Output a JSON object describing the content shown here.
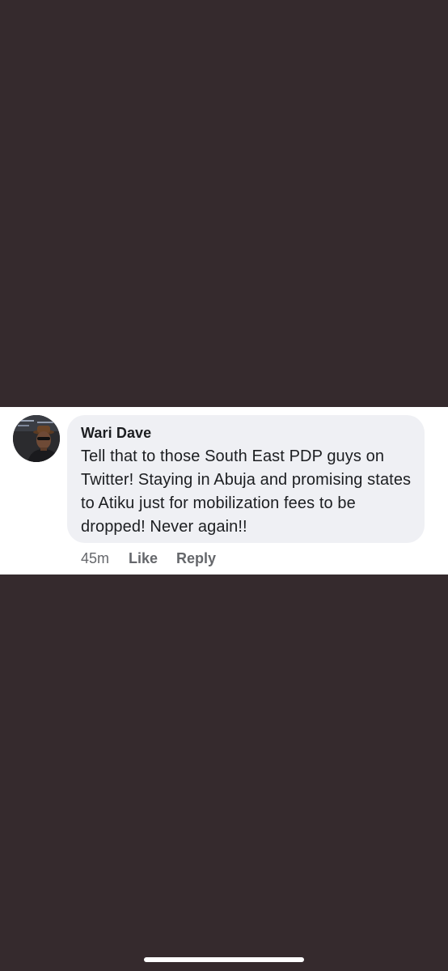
{
  "comment": {
    "author": "Wari Dave",
    "text": "Tell that to those South East PDP guys on Twitter! Staying in Abuja and promising states to Atiku just for mobilization fees to be dropped! Never again!!",
    "time": "45m",
    "like_label": "Like",
    "reply_label": "Reply"
  },
  "colors": {
    "background": "#352a2d",
    "bubble": "#eff0f4",
    "text_primary": "#1c1e21",
    "text_secondary": "#65676b"
  },
  "icons": {
    "avatar": "user-avatar-photo"
  }
}
